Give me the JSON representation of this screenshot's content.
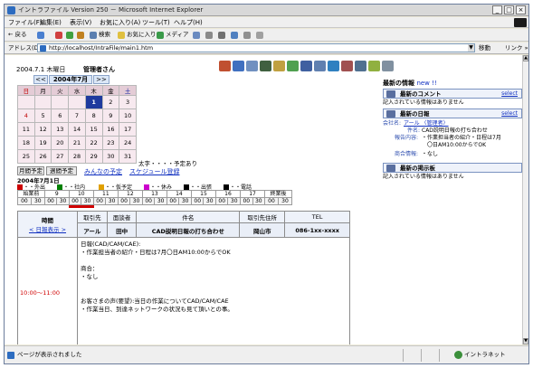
{
  "window": {
    "title": "イントラファイル Version 250 － Microsoft Internet Explorer",
    "controls": [
      "_",
      "□",
      "×"
    ]
  },
  "menu": [
    "ファイル(F)",
    "編集(E)",
    "表示(V)",
    "お気に入り(A)",
    "ツール(T)",
    "ヘルプ(H)"
  ],
  "toolbar": {
    "back": "← 戻る",
    "search": "検索",
    "favorites": "お気に入り",
    "media": "メディア"
  },
  "address": {
    "label": "アドレス(D)",
    "url": "http://localhost/IntraFile/main1.htm",
    "go": "移動",
    "links": "リンク »"
  },
  "page": {
    "date": "2004.7.1 木曜日",
    "user": "管理者さん",
    "calendar": {
      "prev": "<<",
      "month": "2004年7月",
      "next": ">>",
      "weekdays": [
        "日",
        "月",
        "火",
        "水",
        "木",
        "金",
        "土"
      ],
      "weeks": [
        [
          "",
          "",
          "",
          "",
          "1",
          "2",
          "3"
        ],
        [
          "4",
          "5",
          "6",
          "7",
          "8",
          "9",
          "10"
        ],
        [
          "11",
          "12",
          "13",
          "14",
          "15",
          "16",
          "17"
        ],
        [
          "18",
          "19",
          "20",
          "21",
          "22",
          "23",
          "24"
        ],
        [
          "25",
          "26",
          "27",
          "28",
          "29",
          "30",
          "31"
        ]
      ],
      "today": "1"
    },
    "note": "太字・・・・予定あり",
    "buttons": {
      "monthly": "月間予定",
      "weekly": "週間予定",
      "everyone": "みんなの予定",
      "register": "スケジュール登録"
    },
    "day_label": "2004年7月1日",
    "categories": [
      {
        "label": "・・外出",
        "color": "#cc0000"
      },
      {
        "label": "・・社内",
        "color": "#008000"
      },
      {
        "label": "・・仮予定",
        "color": "#e0a000"
      },
      {
        "label": "・・休み",
        "color": "#cc00cc"
      },
      {
        "label": "・・出張",
        "color": "#000000"
      },
      {
        "label": "・・電話",
        "color": "#000000"
      }
    ],
    "time_grid": {
      "hours": [
        "始業前",
        "9",
        "10",
        "11",
        "12",
        "13",
        "14",
        "15",
        "16",
        "17",
        "終業後"
      ],
      "minutes": [
        "00",
        "30",
        "00",
        "30",
        "00",
        "30",
        "00",
        "30",
        "00",
        "30",
        "00",
        "30",
        "00",
        "30",
        "00",
        "30",
        "00",
        "30",
        "00",
        "30",
        "00",
        "30"
      ]
    },
    "schedule": {
      "time_head": "時間",
      "back_link": "< 日報表示 >",
      "columns": [
        "取引先",
        "面談者",
        "件名",
        "取引先住所",
        "TEL"
      ],
      "row": {
        "client": "アール",
        "person": "田中",
        "subject": "CAD説明日報の打ち合わせ",
        "address": "岡山市",
        "tel": "086-1xx-xxxx"
      },
      "time": "10:00～11:00",
      "body": [
        "日報(CAD/CAM/CAE):",
        "・作業担当者の紹介・日程は7月〇日AM10:00からでOK",
        "",
        "商合：",
        "・なし",
        "",
        "",
        "お客さまの声(要望):当日の作業についてCAD/CAM/CAE",
        "・作業当日、到達ネットワークの状況も見て頂いとの事。"
      ]
    }
  },
  "right_panel": {
    "title": "最新の情報",
    "new_tag": "new !!",
    "comment_title": "最新のコメント",
    "comment_link": "select",
    "comment_text": "記入されている情報はありません",
    "report_title": "最新の日報",
    "report_link": "select",
    "report_company_label": "会社名:",
    "report_company": "アール 〈管理者〉",
    "report_subject_label": "件名:",
    "report_subject": "CAD説明日報の打ち合わせ",
    "report_detail_label": "報告内容:",
    "report_detail_1": "・作業担当者の紹介・日程は7月",
    "report_detail_2": "〇日AM10:00からでOK",
    "report_deal_label": "商合情報:",
    "report_deal": "・なし",
    "board_title": "最新の掲示板",
    "board_text": "記入されている情報はありません"
  },
  "status": {
    "message": "ページが表示されました",
    "zone": "イントラネット"
  }
}
